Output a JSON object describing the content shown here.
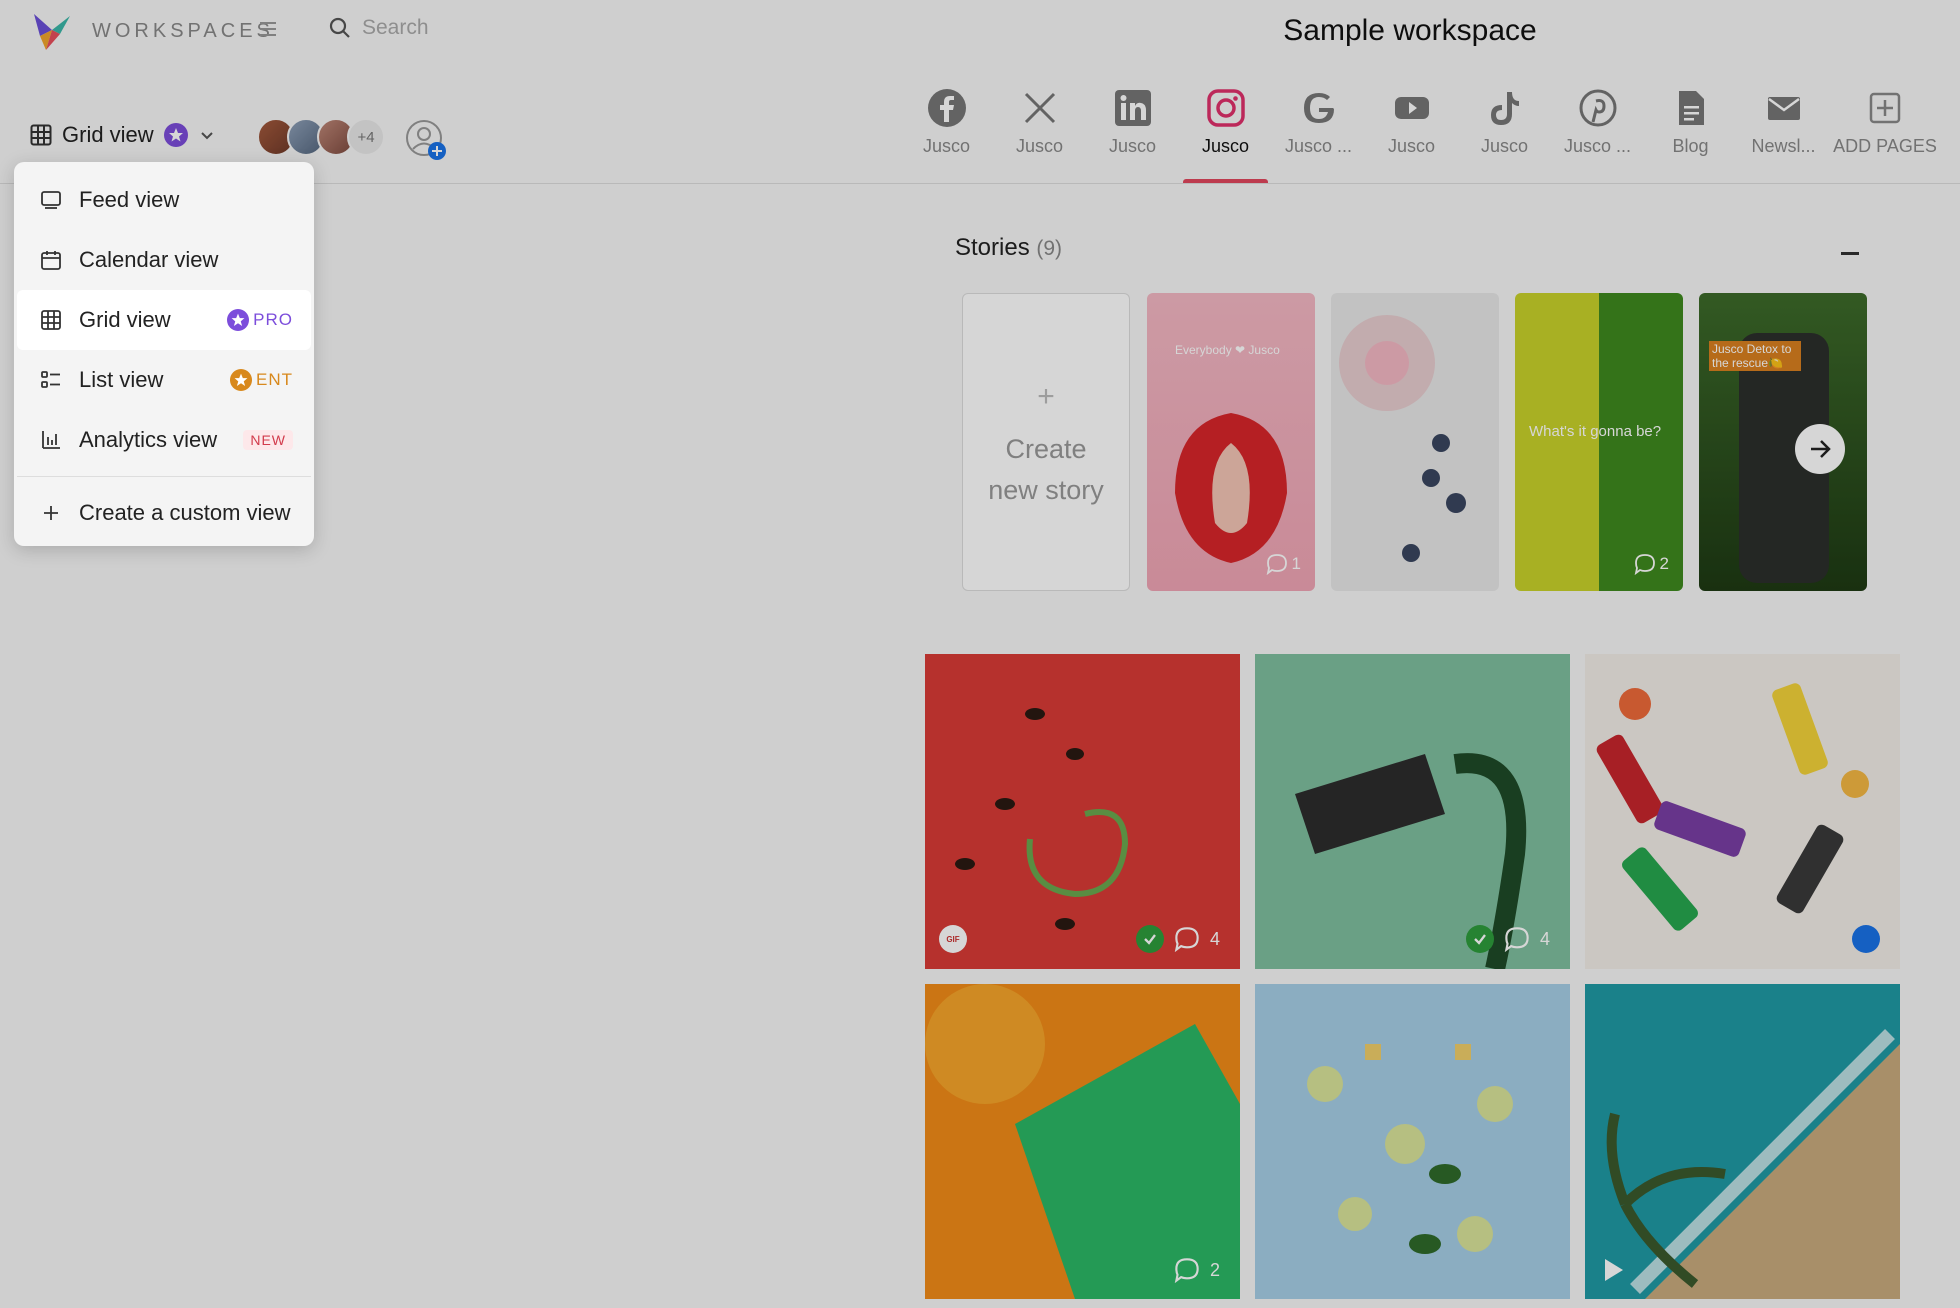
{
  "header": {
    "brand": "WORKSPACES",
    "search_placeholder": "Search",
    "title": "Sample workspace"
  },
  "view_switch": {
    "label": "Grid view"
  },
  "avatars": {
    "extra_count": "+4"
  },
  "tabs": [
    {
      "icon": "facebook-icon",
      "label": "Jusco",
      "active": false
    },
    {
      "icon": "x-icon",
      "label": "Jusco",
      "active": false
    },
    {
      "icon": "linkedin-icon",
      "label": "Jusco",
      "active": false
    },
    {
      "icon": "instagram-icon",
      "label": "Jusco",
      "active": true
    },
    {
      "icon": "google-icon",
      "label": "Jusco ...",
      "active": false
    },
    {
      "icon": "youtube-icon",
      "label": "Jusco",
      "active": false
    },
    {
      "icon": "tiktok-icon",
      "label": "Jusco",
      "active": false
    },
    {
      "icon": "pinterest-icon",
      "label": "Jusco ...",
      "active": false
    },
    {
      "icon": "blog-icon",
      "label": "Blog",
      "active": false
    },
    {
      "icon": "newsletter-icon",
      "label": "Newsl...",
      "active": false
    },
    {
      "icon": "add-pages-icon",
      "label": "ADD PAGES",
      "active": false
    }
  ],
  "colors": {
    "active_tab": "#e2475e",
    "pro": "#7c4ddb",
    "ent": "#d8891d",
    "new": "#d23b4c",
    "approved": "#2e9d3c",
    "scheduled": "#1a73e8"
  },
  "stories": {
    "title": "Stories",
    "count": "(9)",
    "create_label_1": "Create",
    "create_label_2": "new story",
    "items": [
      {
        "caption": "Everybody ❤ Jusco",
        "comments": "1"
      },
      {
        "caption": "",
        "comments": ""
      },
      {
        "caption": "What's it gonna be?",
        "comments": "2"
      },
      {
        "caption": "Jusco Detox to the rescue🍋",
        "comments": ""
      }
    ]
  },
  "grid": [
    {
      "approved": true,
      "comments": "4",
      "gif": "GIF"
    },
    {
      "approved": true,
      "comments": "4"
    },
    {
      "scheduled": true
    },
    {
      "comments": "2"
    },
    {},
    {
      "video": true
    }
  ],
  "dropdown": {
    "items": [
      {
        "icon": "feed-view-icon",
        "label": "Feed view"
      },
      {
        "icon": "calendar-view-icon",
        "label": "Calendar view"
      },
      {
        "icon": "grid-view-icon",
        "label": "Grid view",
        "badge": "PRO"
      },
      {
        "icon": "list-view-icon",
        "label": "List view",
        "badge": "ENT"
      },
      {
        "icon": "analytics-view-icon",
        "label": "Analytics view",
        "badge": "NEW"
      }
    ],
    "custom": "Create a custom view"
  }
}
